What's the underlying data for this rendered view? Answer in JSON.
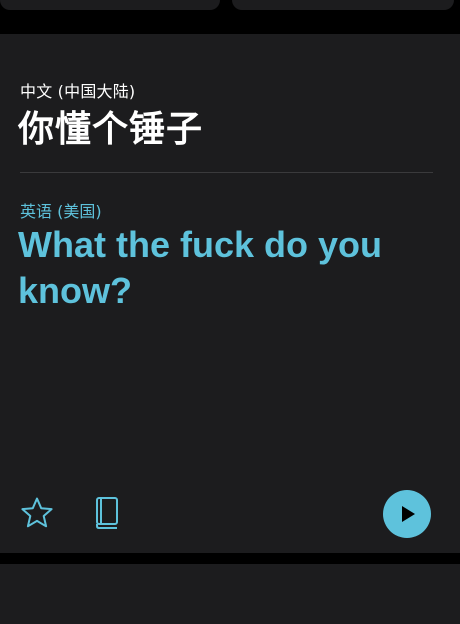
{
  "source": {
    "language": "中文 (中国大陆)",
    "text": "你懂个锤子"
  },
  "target": {
    "language": "英语 (美国)",
    "text": "What the fuck do you know?"
  },
  "toolbar": {
    "favorite_icon": "star-icon",
    "dictionary_icon": "book-icon",
    "play_icon": "play-icon"
  },
  "colors": {
    "accent": "#5ec2dc",
    "card_background": "#1c1c1e",
    "page_background": "#000000",
    "divider": "#3a3a3c"
  }
}
